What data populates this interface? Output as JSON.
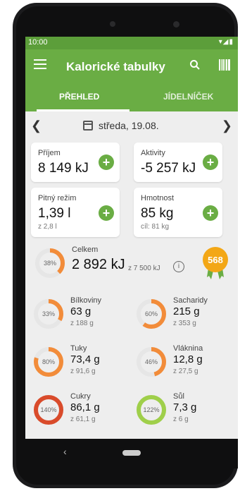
{
  "status": {
    "time": "10:00",
    "icons": "▾◢▮"
  },
  "appbar": {
    "title": "Kalorické tabulky"
  },
  "tabs": [
    {
      "label": "PŘEHLED"
    },
    {
      "label": "JÍDELNÍČEK"
    }
  ],
  "datebar": {
    "date": "středa, 19.08."
  },
  "cards": {
    "prijem": {
      "label": "Příjem",
      "value": "8 149 kJ"
    },
    "aktivity": {
      "label": "Aktivity",
      "value": "-5 257 kJ"
    },
    "pitny": {
      "label": "Pitný režim",
      "value": "1,39 l",
      "sub": "z 2,8 l"
    },
    "hmotnost": {
      "label": "Hmotnost",
      "value": "85 kg",
      "sub": "cíl: 81 kg"
    }
  },
  "total": {
    "label": "Celkem",
    "value": "2 892 kJ",
    "goal": "z 7 500 kJ",
    "percent_text": "38%",
    "progress": 0.38,
    "badge": "568"
  },
  "nutrients": {
    "bilkoviny": {
      "name": "Bílkoviny",
      "value": "63 g",
      "goal": "z 188 g",
      "percent_text": "33%",
      "progress": 0.33,
      "color": "#f28c3a"
    },
    "sacharidy": {
      "name": "Sacharidy",
      "value": "215 g",
      "goal": "z 353 g",
      "percent_text": "60%",
      "progress": 0.6,
      "color": "#f28c3a"
    },
    "tuky": {
      "name": "Tuky",
      "value": "73,4 g",
      "goal": "z 91,6 g",
      "percent_text": "80%",
      "progress": 0.8,
      "color": "#f28c3a"
    },
    "vlaknina": {
      "name": "Vláknina",
      "value": "12,8 g",
      "goal": "z 27,5 g",
      "percent_text": "46%",
      "progress": 0.46,
      "color": "#f28c3a"
    },
    "cukry": {
      "name": "Cukry",
      "value": "86,1 g",
      "goal": "z 61,1 g",
      "percent_text": "140%",
      "progress": 1.0,
      "color": "#d94b2b"
    },
    "sul": {
      "name": "Sůl",
      "value": "7,3 g",
      "goal": "z 6 g",
      "percent_text": "122%",
      "progress": 1.0,
      "color": "#9fcf4a"
    }
  },
  "colors": {
    "primary": "#6aad44",
    "statusbar": "#5c9e3a",
    "ring_track": "#e6e6e6",
    "badge": "#f3a716"
  }
}
